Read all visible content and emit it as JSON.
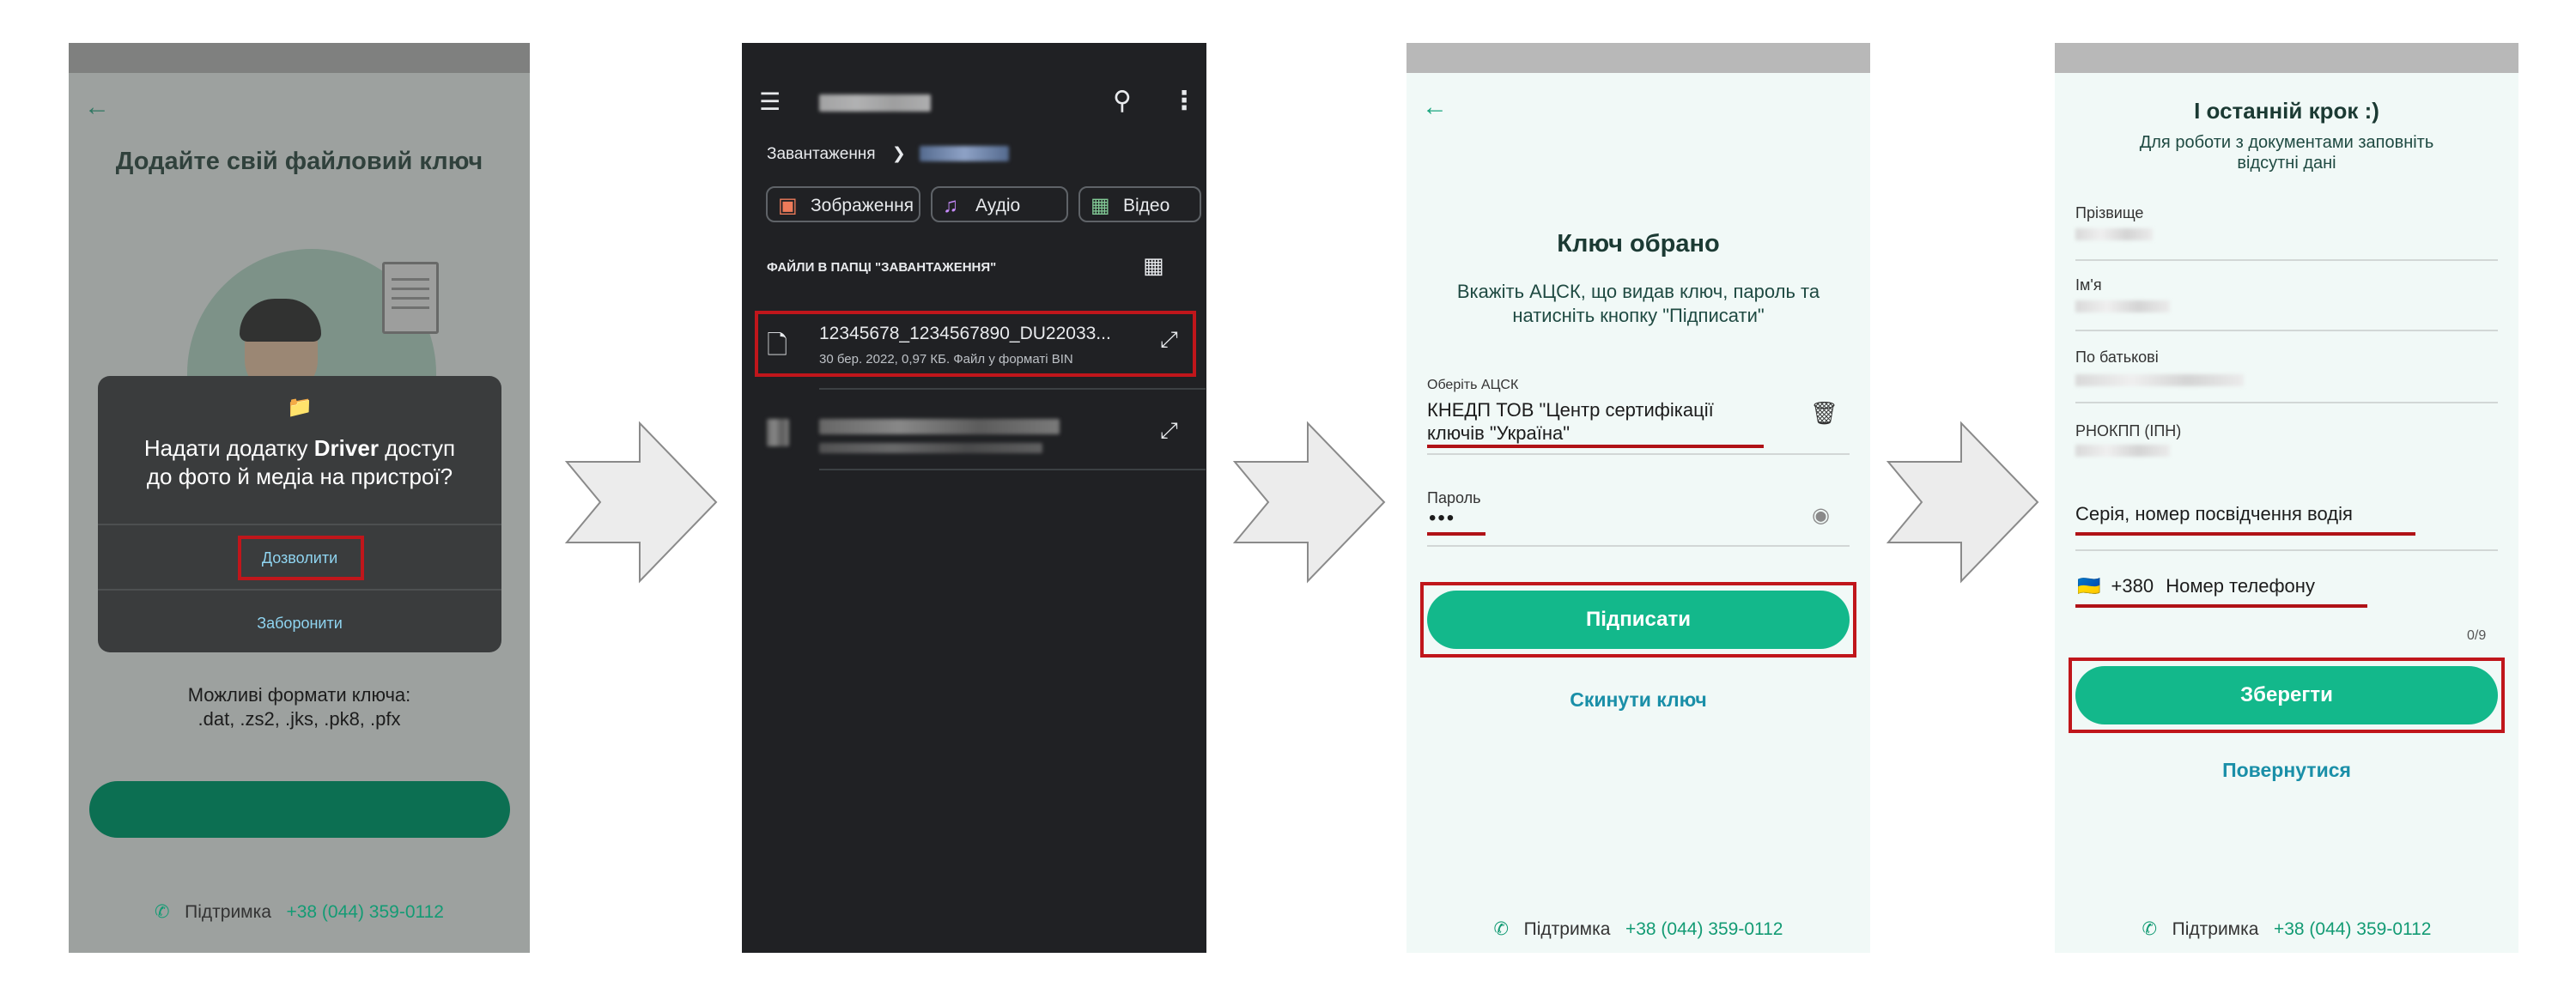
{
  "screen1": {
    "back_icon": "arrow-left-icon",
    "title": "Додайте свій файловий ключ",
    "dialog": {
      "icon": "folder-icon",
      "question_line1_pre": "Надати додатку ",
      "question_app": "Driver",
      "question_line1_post": " доступ",
      "question_line2": "до фото й медіа на пристрої?",
      "allow": "Дозволити",
      "deny": "Заборонити"
    },
    "formats_line1": "Можливі формати ключа:",
    "formats_line2": ".dat, .zs2, .jks, .pk8, .pfx",
    "support_label": "Підтримка",
    "support_phone": "+38 (044) 359-0112"
  },
  "screen2": {
    "breadcrumb_root": "Завантаження",
    "chips": [
      "Зображення",
      "Аудіо",
      "Відео"
    ],
    "section_title": "ФАЙЛИ В ПАПЦІ \"ЗАВАНТАЖЕННЯ\"",
    "selected_file": {
      "name": "12345678_1234567890_DU22033...",
      "meta": "30 бер. 2022, 0,97 КБ. Файл у форматі BIN"
    }
  },
  "screen3": {
    "title": "Ключ обрано",
    "instruction_line1": "Вкажіть АЦСК, що видав ключ, пароль та",
    "instruction_line2": "натисніть кнопку \"Підписати\"",
    "acsk_label": "Оберіть АЦСК",
    "acsk_line1": "КНЕДП ТОВ \"Центр сертифікації",
    "acsk_line2": "ключів \"Україна\"",
    "password_label": "Пароль",
    "password_value": "•••",
    "sign_button": "Підписати",
    "reset_link": "Скинути ключ",
    "support_label": "Підтримка",
    "support_phone": "+38 (044) 359-0112"
  },
  "screen4": {
    "title": "І останній крок :)",
    "subtitle_line1": "Для роботи з документами заповніть",
    "subtitle_line2": "відсутні дані",
    "surname_label": "Прізвище",
    "name_label": "Ім'я",
    "patronymic_label": "По батькові",
    "tax_label": "РНОКПП (ІПН)",
    "license_placeholder": "Серія, номер посвідчення водія",
    "phone_flag": "🇺🇦",
    "phone_code": "+380",
    "phone_placeholder": "Номер телефону",
    "phone_counter": "0/9",
    "save_button": "Зберегти",
    "back_link": "Повернутися",
    "support_label": "Підтримка",
    "support_phone": "+38 (044) 359-0112"
  }
}
